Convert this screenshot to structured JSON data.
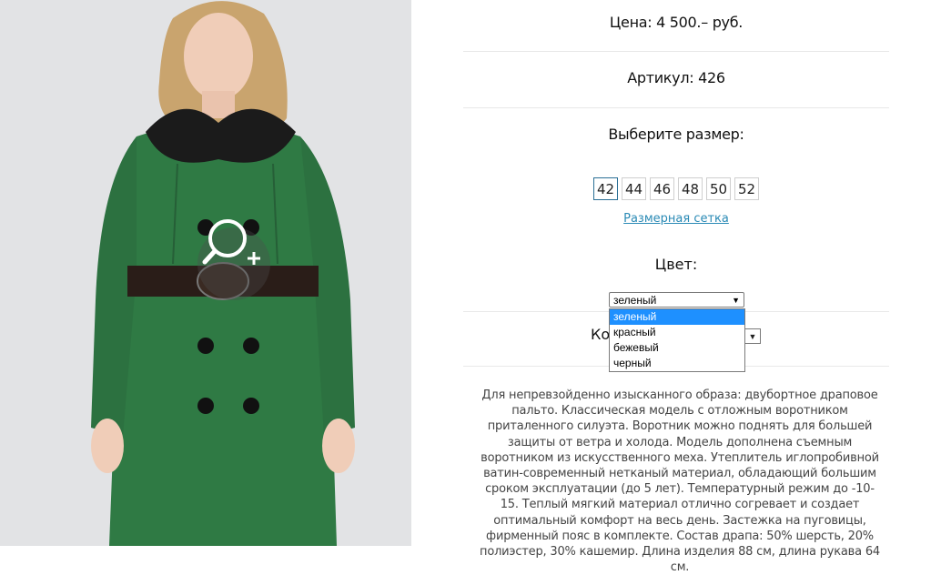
{
  "product": {
    "price_label": "Цена: 4 500.– руб.",
    "sku_label": "Артикул: 426",
    "size_title": "Выберите размер:",
    "sizes": [
      "42",
      "44",
      "46",
      "48",
      "50",
      "52"
    ],
    "selected_size": "42",
    "size_chart_link": "Размерная сетка",
    "color_title": "Цвет:",
    "color_select": {
      "selected": "зеленый",
      "options": [
        "зеленый",
        "красный",
        "бежевый",
        "черный"
      ]
    },
    "quantity_label_partial": "Ко",
    "description": "Для непревзойденно изысканного образа: двубортное драповое пальто. Классическая модель с отложным воротником приталенного силуэта. Воротник можно поднять для большей защиты от ветра и холода. Модель дополнена съемным воротником из искусственного меха. Утеплитель иглопробивной ватин-современный нетканый материал, обладающий большим сроком эксплуатации (до 5 лет). Температурный режим до -10-15. Теплый мягкий материал отлично согревает и создает оптимальный комфорт на весь день. Застежка на пуговицы, фирменный пояс в комплекте. Состав драпа: 50% шерсть, 20% полиэстер, 30% кашемир. Длина изделия 88 см, длина рукава 64 см."
  },
  "colors": {
    "coat": "#2f7a44",
    "link": "#2a8ab5",
    "selected_option_bg": "#1e90ff",
    "selected_size_border": "#2a6f96"
  },
  "icons": {
    "zoom": "magnifier-plus-icon",
    "select_arrow": "triangle-down-icon"
  }
}
